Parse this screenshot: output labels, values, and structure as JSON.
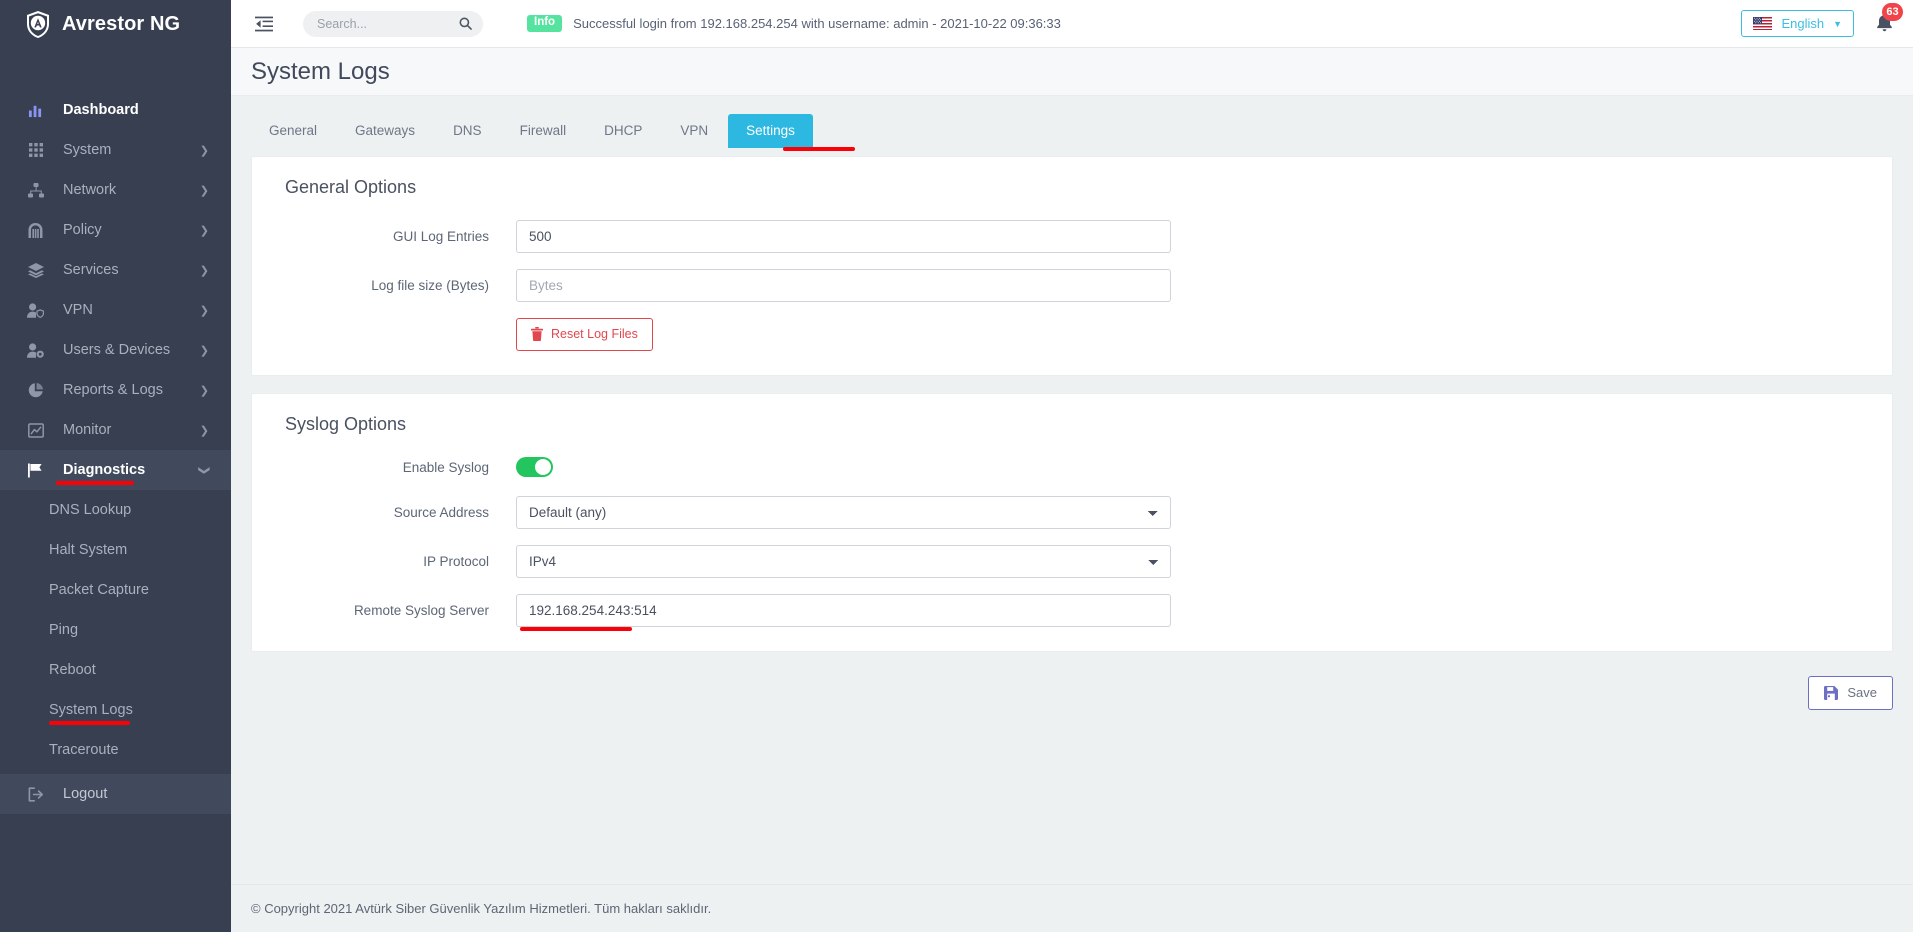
{
  "brand": {
    "name": "Avrestor NG",
    "logo_icon": "shield-a-logo"
  },
  "sidebar": {
    "items": [
      {
        "label": "Dashboard",
        "icon": "bar-chart-icon",
        "has_chevron": false,
        "state": "highlight"
      },
      {
        "label": "System",
        "icon": "grid-icon",
        "has_chevron": true,
        "state": "normal"
      },
      {
        "label": "Network",
        "icon": "sitemap-icon",
        "has_chevron": true,
        "state": "normal"
      },
      {
        "label": "Policy",
        "icon": "gate-icon",
        "has_chevron": true,
        "state": "normal"
      },
      {
        "label": "Services",
        "icon": "layers-icon",
        "has_chevron": true,
        "state": "normal"
      },
      {
        "label": "VPN",
        "icon": "user-shield-icon",
        "has_chevron": true,
        "state": "normal"
      },
      {
        "label": "Users & Devices",
        "icon": "user-cog-icon",
        "has_chevron": true,
        "state": "normal"
      },
      {
        "label": "Reports & Logs",
        "icon": "pie-chart-icon",
        "has_chevron": true,
        "state": "normal"
      },
      {
        "label": "Monitor",
        "icon": "chart-line-icon",
        "has_chevron": true,
        "state": "normal"
      },
      {
        "label": "Diagnostics",
        "icon": "flag-icon",
        "has_chevron": true,
        "state": "active"
      }
    ],
    "sub_items": [
      {
        "label": "DNS Lookup"
      },
      {
        "label": "Halt System"
      },
      {
        "label": "Packet Capture"
      },
      {
        "label": "Ping"
      },
      {
        "label": "Reboot"
      },
      {
        "label": "System Logs"
      },
      {
        "label": "Traceroute"
      }
    ],
    "logout": {
      "label": "Logout",
      "icon": "logout-icon"
    }
  },
  "topbar": {
    "collapse_icon": "sidebar-collapse-icon",
    "search": {
      "placeholder": "Search...",
      "value": "",
      "icon": "search-icon"
    },
    "alert": {
      "badge": "Info",
      "message": "Successful login from 192.168.254.254 with username: admin - 2021-10-22 09:36:33"
    },
    "language": {
      "label": "English",
      "flag_icon": "us-flag-icon",
      "caret_icon": "chevron-down-icon"
    },
    "notifications": {
      "count": "63",
      "icon": "bell-icon"
    }
  },
  "page": {
    "title": "System Logs",
    "tabs": [
      {
        "label": "General",
        "active": false
      },
      {
        "label": "Gateways",
        "active": false
      },
      {
        "label": "DNS",
        "active": false
      },
      {
        "label": "Firewall",
        "active": false
      },
      {
        "label": "DHCP",
        "active": false
      },
      {
        "label": "VPN",
        "active": false
      },
      {
        "label": "Settings",
        "active": true
      }
    ]
  },
  "general_options": {
    "title": "General Options",
    "gui_log_entries": {
      "label": "GUI Log Entries",
      "value": "500",
      "placeholder": ""
    },
    "log_file_size": {
      "label": "Log file size (Bytes)",
      "value": "",
      "placeholder": "Bytes"
    },
    "reset_button": {
      "label": "Reset Log Files",
      "icon": "trash-icon"
    }
  },
  "syslog_options": {
    "title": "Syslog Options",
    "enable_syslog": {
      "label": "Enable Syslog",
      "value": "on"
    },
    "source_address": {
      "label": "Source Address",
      "value": "Default (any)"
    },
    "ip_protocol": {
      "label": "IP Protocol",
      "value": "IPv4"
    },
    "remote_syslog_server": {
      "label": "Remote Syslog Server",
      "value": "192.168.254.243:514",
      "placeholder": ""
    }
  },
  "save": {
    "label": "Save",
    "icon": "save-icon"
  },
  "footer": {
    "text": "© Copyright 2021 Avtürk Siber Güvenlik Yazılım Hizmetleri. Tüm hakları saklıdır."
  },
  "colors": {
    "sidebar_bg": "#373f50",
    "accent_tab": "#2cb8e0",
    "marker_red": "#fb0007",
    "toggle_green": "#22c55e",
    "info_badge": "#56e39f",
    "save_purple": "#6c6fc4",
    "danger_red": "#e2474d",
    "bell_badge_red": "#f0444a",
    "lang_cyan": "#3bbfe0"
  }
}
